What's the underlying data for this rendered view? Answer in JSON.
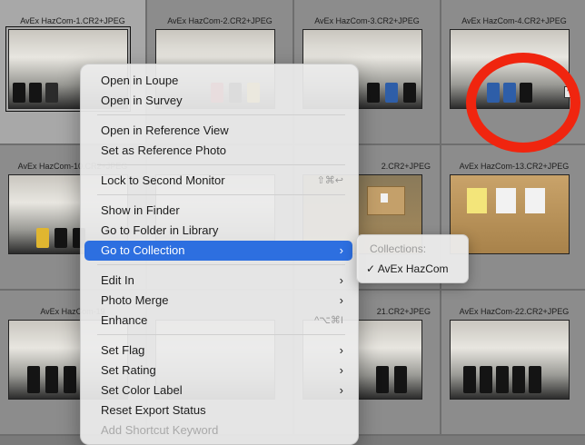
{
  "grid": {
    "captions": {
      "c1": "AvEx HazCom-1.CR2+JPEG",
      "c2": "AvEx HazCom-2.CR2+JPEG",
      "c3": "AvEx HazCom-3.CR2+JPEG",
      "c4": "AvEx HazCom-4.CR2+JPEG",
      "c10": "AvEx HazCom-10.CR2+JPEG",
      "c12": "2.CR2+JPEG",
      "c13": "AvEx HazCom-13.CR2+JPEG",
      "c19": "AvEx HazCom-19",
      "c21": "21.CR2+JPEG",
      "c22": "AvEx HazCom-22.CR2+JPEG"
    }
  },
  "menu": {
    "open_loupe": "Open in Loupe",
    "open_survey": "Open in Survey",
    "open_reference": "Open in Reference View",
    "set_reference": "Set as Reference Photo",
    "lock_monitor": "Lock to Second Monitor",
    "lock_monitor_shortcut": "⇧⌘↩",
    "show_finder": "Show in Finder",
    "goto_folder": "Go to Folder in Library",
    "goto_collection": "Go to Collection",
    "edit_in": "Edit In",
    "photo_merge": "Photo Merge",
    "enhance": "Enhance",
    "enhance_shortcut": "^⌥⌘I",
    "set_flag": "Set Flag",
    "set_rating": "Set Rating",
    "set_color_label": "Set Color Label",
    "reset_export": "Reset Export Status",
    "add_shortcut_keyword": "Add Shortcut Keyword"
  },
  "submenu": {
    "heading": "Collections:",
    "check": "✓",
    "item": "AvEx HazCom"
  },
  "colors": {
    "highlight": "#2d6fe0",
    "annotation_ring": "#f0250f"
  }
}
